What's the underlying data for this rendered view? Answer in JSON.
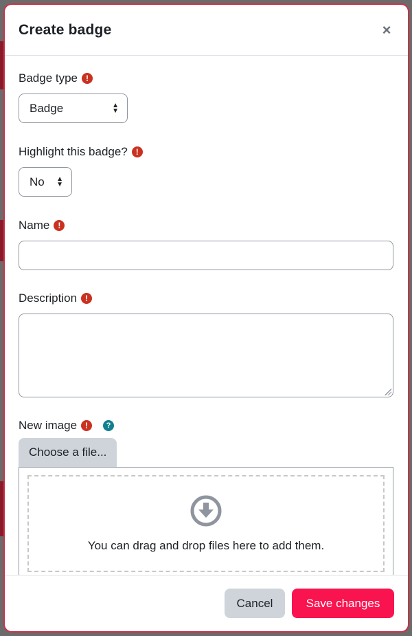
{
  "modal": {
    "title": "Create badge",
    "close_icon": "close-icon"
  },
  "fields": {
    "badge_type": {
      "label": "Badge type",
      "value": "Badge",
      "required_icon": "exclamation-circle-icon"
    },
    "highlight": {
      "label": "Highlight this badge?",
      "value": "No",
      "required_icon": "exclamation-circle-icon"
    },
    "name": {
      "label": "Name",
      "value": "",
      "required_icon": "exclamation-circle-icon"
    },
    "description": {
      "label": "Description",
      "value": "",
      "required_icon": "exclamation-circle-icon"
    },
    "new_image": {
      "label": "New image",
      "required_icon": "exclamation-circle-icon",
      "help_icon": "question-circle-icon",
      "choose_label": "Choose a file...",
      "drop_text": "You can drag and drop files here to add them.",
      "drop_icon": "arrow-down-circle-icon"
    }
  },
  "footer": {
    "cancel_label": "Cancel",
    "save_label": "Save changes"
  },
  "colors": {
    "required": "#ca3120",
    "help": "#10808f",
    "primary": "#f9134f",
    "secondary": "#ced4da"
  }
}
